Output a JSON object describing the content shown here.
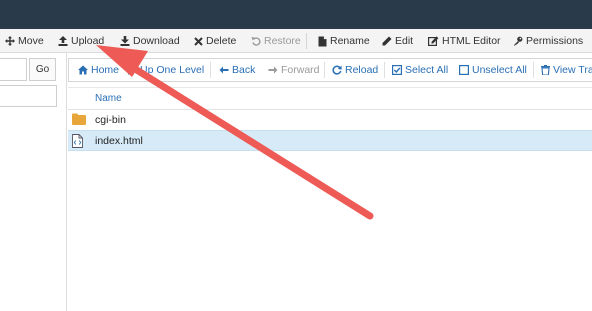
{
  "toolbar": {
    "move": "Move",
    "upload": "Upload",
    "download": "Download",
    "delete": "Delete",
    "restore": "Restore",
    "rename": "Rename",
    "edit": "Edit",
    "html_editor": "HTML Editor",
    "permissions": "Permissions"
  },
  "sidebar": {
    "go_label": "Go"
  },
  "navbar": {
    "home": "Home",
    "up_one_level": "Up One Level",
    "back": "Back",
    "forward": "Forward",
    "reload": "Reload",
    "select_all": "Select All",
    "unselect_all": "Unselect All",
    "view_trash": "View Trash"
  },
  "table": {
    "column_name": "Name",
    "rows": [
      {
        "name": "cgi-bin",
        "type": "folder",
        "selected": false
      },
      {
        "name": "index.html",
        "type": "html-file",
        "selected": true
      }
    ]
  },
  "colors": {
    "topbar": "#293a4a",
    "link": "#2a6fb4",
    "selected_row": "#d6ebf7",
    "folder": "#e8a63a",
    "annotation_arrow": "#ee5a55"
  }
}
